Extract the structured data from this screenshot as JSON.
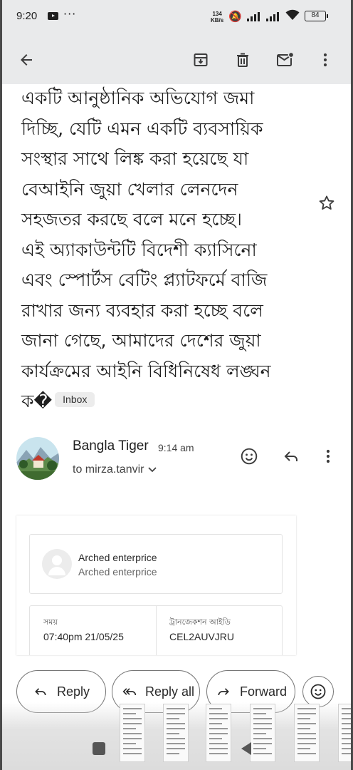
{
  "status_bar": {
    "time": "9:20",
    "net_speed_value": "134",
    "net_speed_unit": "KB/s",
    "battery": "84"
  },
  "toolbar": {
    "icons": [
      "back-arrow-icon",
      "archive-icon",
      "delete-icon",
      "mark-unread-icon",
      "more-vert-icon"
    ]
  },
  "email": {
    "body_lines": [
      "একটি আনুষ্ঠানিক অভিযোগ জমা",
      "দিচ্ছি, যেটি এমন একটি ব্যবসায়িক",
      "সংস্থার সাথে লিঙ্ক করা হয়েছে যা",
      "বেআইনি জুয়া খেলার লেনদেন",
      "সহজতর করছে বলে মনে হচ্ছে।",
      "এই অ্যাকাউন্টটি বিদেশী ক্যাসিনো",
      "এবং স্পোর্টস বেটিং প্ল্যাটফর্মে বাজি",
      "রাখার জন্য ব্যবহার করা হচ্ছে বলে",
      "জানা গেছে, আমাদের দেশের জুয়া",
      "কার্যক্রমের আইনি বিধিনিষেধ লঙ্ঘন"
    ],
    "last_line": "ক�",
    "label": "Inbox",
    "sender": {
      "name": "Bangla Tiger",
      "time": "9:14 am",
      "to": "to mirza.tanvir"
    }
  },
  "receipt": {
    "merchant_name": "Arched enterprice",
    "merchant_sub": "Arched enterprice",
    "time_label": "সময়",
    "time_value": "07:40pm 21/05/25",
    "txn_label": "ট্রানজেকশন আইডি",
    "txn_value": "CEL2AUVJRU"
  },
  "actions": {
    "reply": "Reply",
    "reply_all": "Reply all",
    "forward": "Forward"
  },
  "colors": {
    "toolbar_bg": "#e9eaeb",
    "text": "#1f1f1f"
  }
}
